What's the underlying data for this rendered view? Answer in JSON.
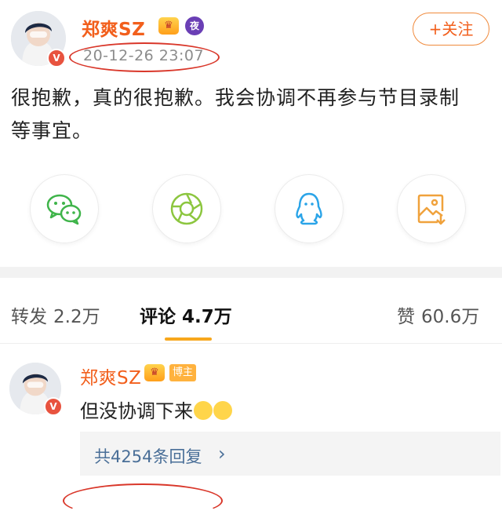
{
  "post": {
    "author": "郑爽SZ",
    "timestamp": "20-12-26 23:07",
    "follow_label": "关注",
    "follow_plus": "+",
    "vip_badge_icon": "crown-icon",
    "night_badge": "夜",
    "verified_badge": "V",
    "text_line1": "很抱歉，真的很抱歉。我会协调不再参与节目录制",
    "text_line2": "等事宜。"
  },
  "share": {
    "items": [
      {
        "name": "wechat-icon",
        "color": "#3fb44a"
      },
      {
        "name": "moments-icon",
        "color": "#8cc63f"
      },
      {
        "name": "qq-icon",
        "color": "#2aa4e8"
      },
      {
        "name": "save-image-icon",
        "color": "#f0a23c"
      }
    ]
  },
  "tabs": {
    "repost_label": "转发",
    "repost_count": "2.2万",
    "comment_label": "评论",
    "comment_count": "4.7万",
    "like_label": "赞",
    "like_count": "60.6万"
  },
  "comment": {
    "author": "郑爽SZ",
    "author_badge": "博主",
    "verified_badge": "V",
    "text": "但没协调下来",
    "emojis": [
      "smirk-emoji-icon",
      "sweat-emoji-icon"
    ],
    "reply_count_label": "共4254条回复",
    "reply_chevron": "›"
  },
  "colors": {
    "accent": "#f25f1c",
    "annotation_red": "#d9372a",
    "tab_underline": "#f7a71d",
    "link": "#4a6f98"
  }
}
